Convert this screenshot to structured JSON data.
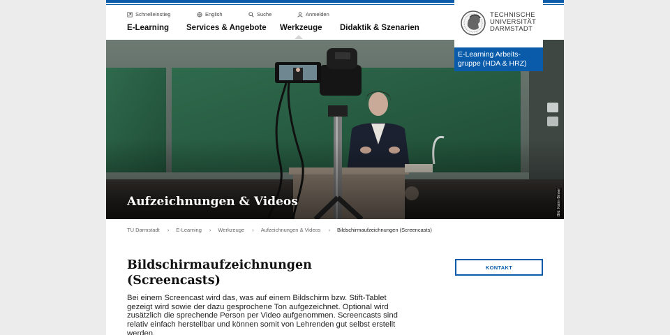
{
  "utility_nav": [
    {
      "label": "Schnelleinstieg",
      "icon": "quick-access-icon"
    },
    {
      "label": "English",
      "icon": "globe-icon"
    },
    {
      "label": "Suche",
      "icon": "search-icon"
    },
    {
      "label": "Anmelden",
      "icon": "user-icon"
    }
  ],
  "main_nav": [
    {
      "label": "E-Learning"
    },
    {
      "label": "Services & Angebote"
    },
    {
      "label": "Werkzeuge"
    },
    {
      "label": "Didaktik & Szenarien"
    }
  ],
  "logo": {
    "line1": "TECHNISCHE",
    "line2": "UNIVERSITÄT",
    "line3": "DARMSTADT"
  },
  "group_label": "E-Learning Arbeits-gruppe (HDA & HRZ)",
  "hero": {
    "title": "Aufzeichnungen & Videos",
    "credit": "Bild: Katrin Binner"
  },
  "breadcrumb": [
    {
      "label": "TU Darmstadt"
    },
    {
      "label": "E-Learning"
    },
    {
      "label": "Werkzeuge"
    },
    {
      "label": "Aufzeichnungen & Videos"
    },
    {
      "label": "Bildschirmaufzeichnungen (Screencasts)"
    }
  ],
  "content": {
    "title": "Bildschirmaufzeichnungen (Screencasts)",
    "text": "Bei einem Screencast wird das, was auf einem Bildschirm bzw. Stift-Tablet gezeigt wird sowie der dazu gesprochene Ton aufgezeichnet. Optional wird zusätzlich die sprechende Person per Video aufgenommen. Screencasts sind relativ einfach herstellbar und können somit von Lehrenden gut selbst erstellt werden."
  },
  "contact_button": "KONTAKT",
  "colors": {
    "brand_blue": "#0a5cab",
    "background": "#ececec"
  }
}
